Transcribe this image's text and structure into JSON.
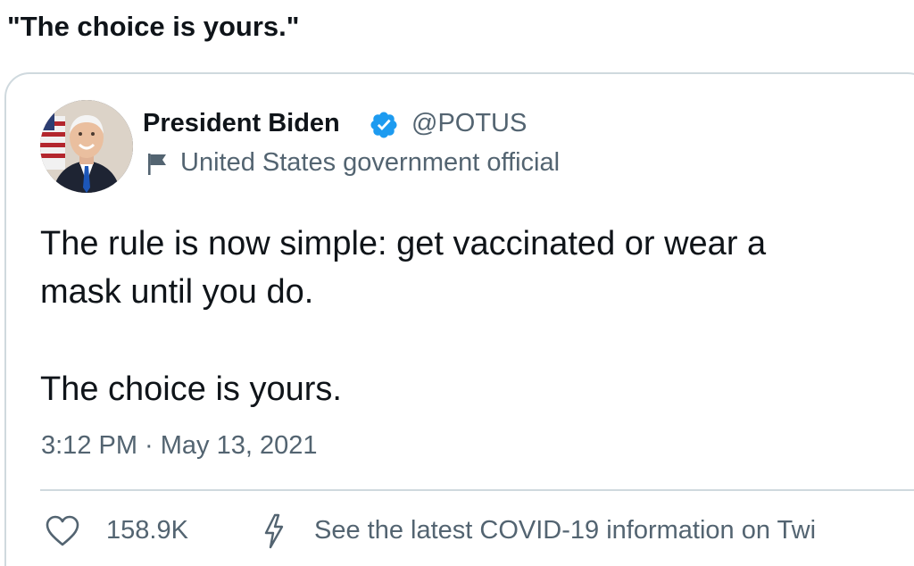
{
  "caption": {
    "text": "\"The choice is yours.\""
  },
  "quoted_tweet": {
    "author": {
      "name": "President Biden",
      "handle": "@POTUS",
      "label": "United States government official",
      "verified": true,
      "avatar_icon": "portrait-avatar"
    },
    "text_lines": [
      "The rule is now simple: get vaccinated or wear a",
      "mask until you do.",
      "The choice is yours."
    ],
    "timestamp": "3:12 PM · May 13, 2021",
    "likes": "158.9K",
    "info_link": "See the latest COVID-19 information on Twi"
  },
  "colors": {
    "text_primary": "#0f1419",
    "text_secondary": "#536471",
    "verified_blue": "#1d9bf0",
    "border": "#cfd9de"
  },
  "icons": [
    "verified-badge-icon",
    "flag-icon",
    "heart-icon",
    "lightning-bolt-icon"
  ]
}
